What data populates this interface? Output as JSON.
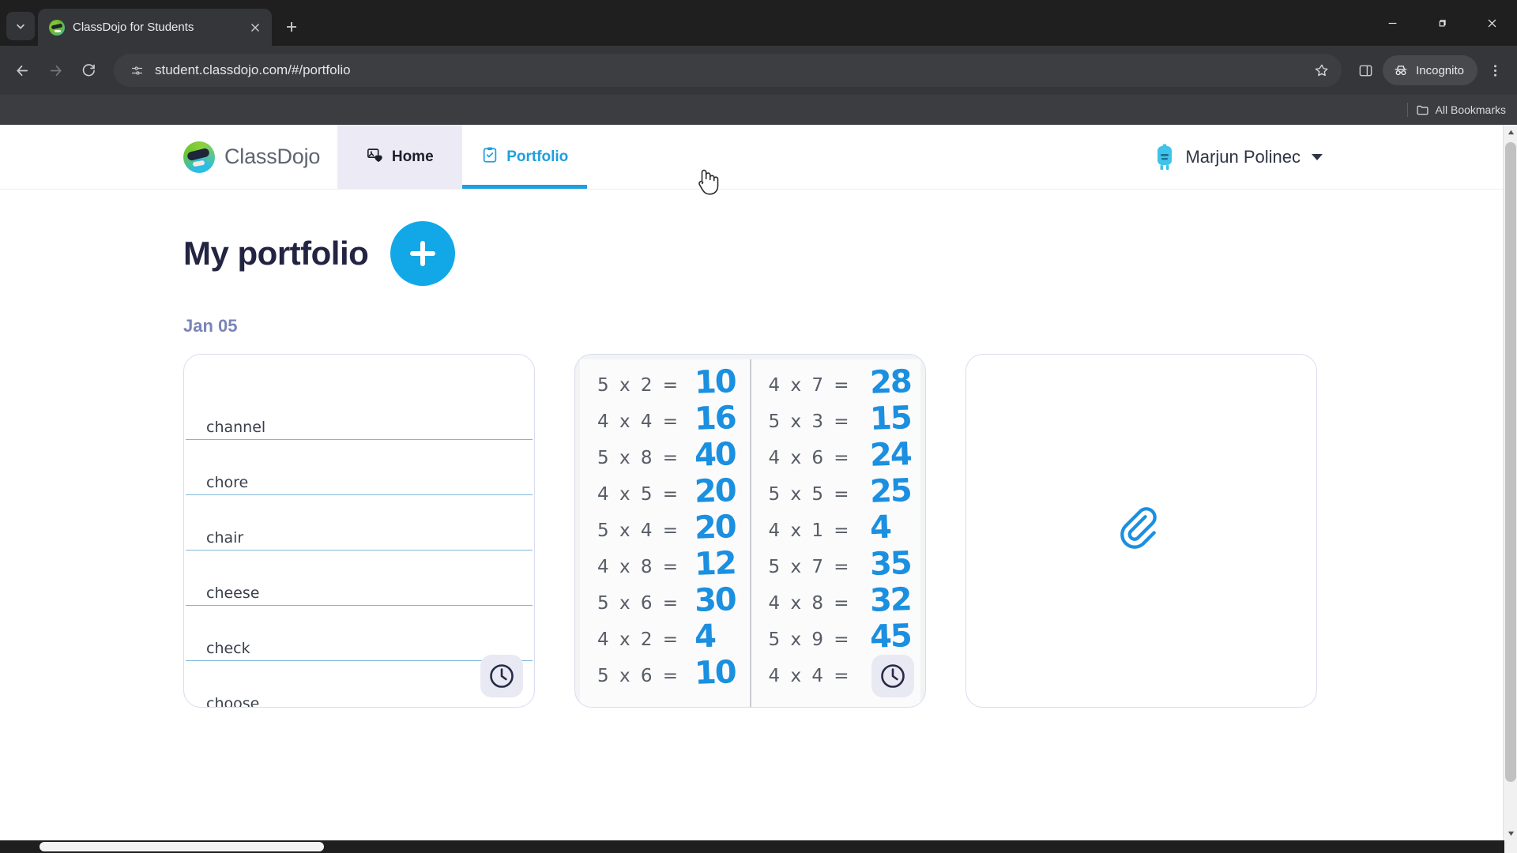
{
  "browser": {
    "tab": {
      "title": "ClassDojo for Students",
      "favicon": "classdojo-favicon"
    },
    "tab_search_tooltip": "Search tabs",
    "new_tab_label": "New Tab",
    "url": "student.classdojo.com/#/portfolio",
    "url_host": "student.classdojo.com",
    "url_path": "/#/portfolio",
    "profile_label": "Incognito",
    "bookmarks": {
      "all_bookmarks_label": "All Bookmarks"
    },
    "window_controls": {
      "minimize": "–",
      "maximize": "❐",
      "close": "✕"
    }
  },
  "app": {
    "brand": "ClassDojo",
    "nav": [
      {
        "label": "Home",
        "icon": "photo-heart-icon",
        "state": "hovered"
      },
      {
        "label": "Portfolio",
        "icon": "clipboard-check-icon",
        "state": "active"
      }
    ],
    "user": {
      "name": "Marjun Polinec",
      "avatar": "monster-avatar",
      "caret": "chevron-down-icon"
    }
  },
  "main": {
    "title": "My portfolio",
    "add_button_label": "+",
    "date_group": "Jan 05",
    "cards": [
      {
        "type": "word-list",
        "words": [
          "channel",
          "chore",
          "chair",
          "cheese",
          "check",
          "choose"
        ],
        "badge": "clock-icon"
      },
      {
        "type": "math-worksheet",
        "badge": "clock-icon",
        "columns": [
          {
            "problems": [
              {
                "q": "5 x 2  =",
                "a": "10"
              },
              {
                "q": "4 x 4  =",
                "a": "16"
              },
              {
                "q": "5 x 8  =",
                "a": "40"
              },
              {
                "q": "4 x 5  =",
                "a": "20"
              },
              {
                "q": "5 x 4  =",
                "a": "20"
              },
              {
                "q": "4 x 8  =",
                "a": "12"
              },
              {
                "q": "5 x 6  =",
                "a": "30"
              },
              {
                "q": "4 x 2  =",
                "a": "4"
              },
              {
                "q": "5 x 6  =",
                "a": "10"
              }
            ]
          },
          {
            "problems": [
              {
                "q": "4 x 7  =",
                "a": "28"
              },
              {
                "q": "5 x 3  =",
                "a": "15"
              },
              {
                "q": "4 x 6  =",
                "a": "24"
              },
              {
                "q": "5 x 5  =",
                "a": "25"
              },
              {
                "q": "4 x 1  =",
                "a": "4"
              },
              {
                "q": "5 x 7  =",
                "a": "35"
              },
              {
                "q": "4 x 8  =",
                "a": "32"
              },
              {
                "q": "5 x 9  =",
                "a": "45"
              },
              {
                "q": "4 x 4  =",
                "a": "!"
              }
            ]
          }
        ]
      },
      {
        "type": "attachment-placeholder",
        "icon": "paperclip-icon"
      }
    ]
  },
  "colors": {
    "accent_blue": "#12a8e8",
    "ink_blue": "#1b8fe0",
    "title_navy": "#232442",
    "date_purple": "#7a84b6",
    "card_border": "#d9dcf0",
    "chrome_dark": "#1f1f1f",
    "toolbar": "#35363a"
  }
}
